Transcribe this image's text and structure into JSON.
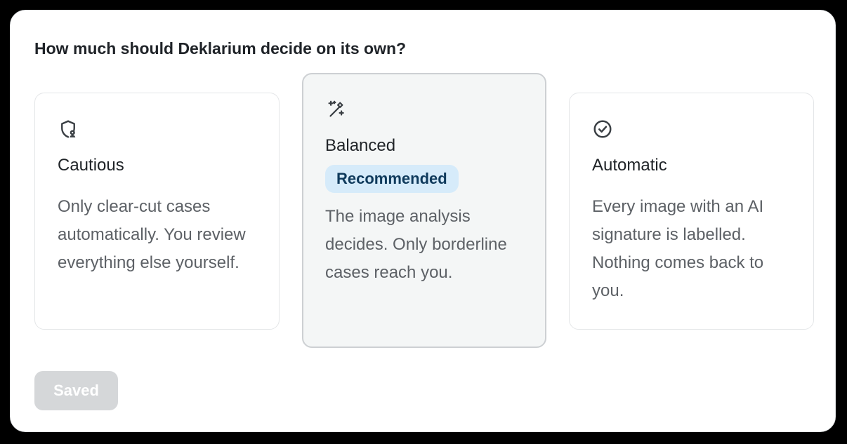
{
  "question": "How much should Deklarium decide on its own?",
  "options": [
    {
      "title": "Cautious",
      "icon": "shield-user-icon",
      "description": "Only clear-cut cases automatically. You review everything else yourself.",
      "selected": false
    },
    {
      "title": "Balanced",
      "icon": "magic-wand-icon",
      "badge": "Recommended",
      "description": "The image analysis decides. Only borderline cases reach you.",
      "selected": true
    },
    {
      "title": "Automatic",
      "icon": "check-circle-icon",
      "description": "Every image with an AI signature is labelled. Nothing comes back to you.",
      "selected": false
    }
  ],
  "save_button": {
    "label": "Saved",
    "disabled": true
  },
  "colors": {
    "badge_background": "#d6ebfa",
    "badge_text": "#0f3a5c",
    "selected_card_background": "#f4f6f6",
    "disabled_button": "#d5d7d9"
  }
}
